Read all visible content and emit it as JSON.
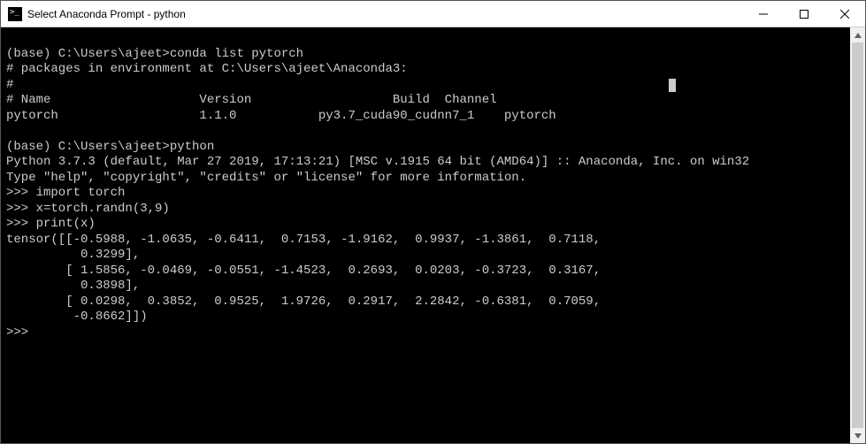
{
  "window": {
    "title": "Select Anaconda Prompt - python"
  },
  "terminal": {
    "lines": [
      "",
      "(base) C:\\Users\\ajeet>conda list pytorch",
      "# packages in environment at C:\\Users\\ajeet\\Anaconda3:",
      "#",
      "# Name                    Version                   Build  Channel",
      "pytorch                   1.1.0           py3.7_cuda90_cudnn7_1    pytorch",
      "",
      "(base) C:\\Users\\ajeet>python",
      "Python 3.7.3 (default, Mar 27 2019, 17:13:21) [MSC v.1915 64 bit (AMD64)] :: Anaconda, Inc. on win32",
      "Type \"help\", \"copyright\", \"credits\" or \"license\" for more information.",
      ">>> import torch",
      ">>> x=torch.randn(3,9)",
      ">>> print(x)",
      "tensor([[-0.5988, -1.0635, -0.6411,  0.7153, -1.9162,  0.9937, -1.3861,  0.7118,",
      "          0.3299],",
      "        [ 1.5856, -0.0469, -0.0551, -1.4523,  0.2693,  0.0203, -0.3723,  0.3167,",
      "          0.3898],",
      "        [ 0.0298,  0.3852,  0.9525,  1.9726,  0.2917,  2.2842, -0.6381,  0.7059,",
      "         -0.8662]])",
      ">>>"
    ]
  }
}
